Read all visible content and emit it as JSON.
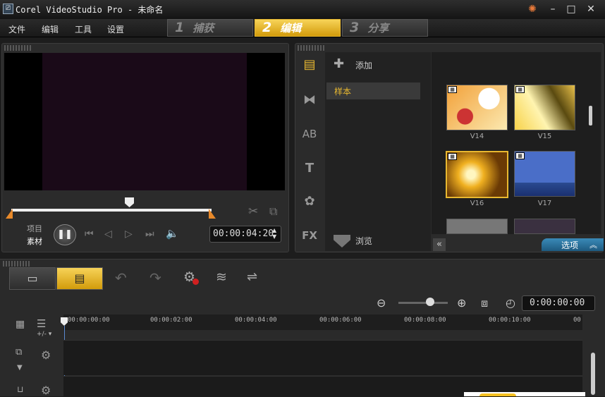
{
  "window": {
    "title": "Corel VideoStudio Pro - 未命名"
  },
  "menu": [
    "文件",
    "编辑",
    "工具",
    "设置"
  ],
  "steps": [
    {
      "num": "1",
      "label": "捕获"
    },
    {
      "num": "2",
      "label": "编辑"
    },
    {
      "num": "3",
      "label": "分享"
    }
  ],
  "player": {
    "project_label": "项目",
    "clip_label": "素材",
    "timecode": "00:00:04:20"
  },
  "library": {
    "add_label": "添加",
    "folder_item": "样本",
    "browse_label": "浏览",
    "options_label": "选项"
  },
  "thumbnails": [
    {
      "label": "V14"
    },
    {
      "label": "V15"
    },
    {
      "label": "V16"
    },
    {
      "label": "V17"
    }
  ],
  "timeline": {
    "timecode": "0:00:00:00",
    "ruler": [
      "00:00:00:00",
      "00:00:02:00",
      "00:00:04:00",
      "00:00:06:00",
      "00:00:08:00",
      "00:00:10:00",
      "00"
    ],
    "add_remove": "+/-"
  },
  "colors": {
    "accent": "#e8b830",
    "panel": "#2b2b2b"
  }
}
